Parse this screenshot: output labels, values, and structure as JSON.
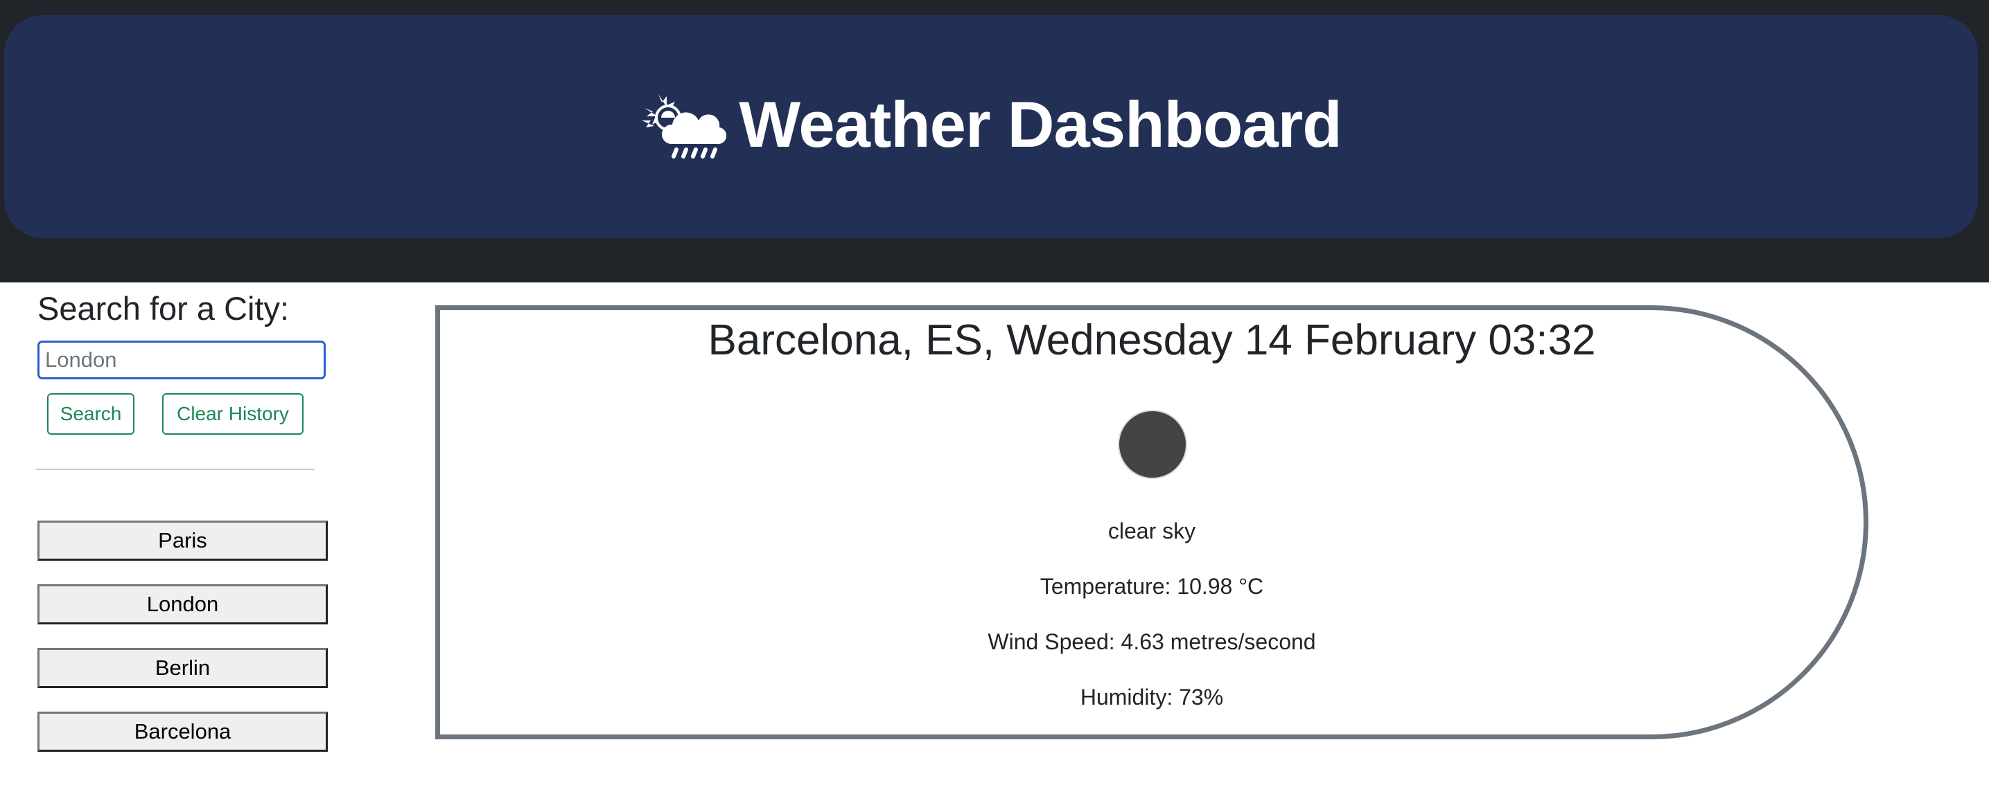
{
  "header": {
    "title": "Weather Dashboard",
    "icon": "cloud-sun-rain-icon"
  },
  "sidebar": {
    "heading": "Search for a City:",
    "search": {
      "value": "",
      "placeholder": "London"
    },
    "search_button_label": "Search",
    "clear_button_label": "Clear History",
    "history": [
      "Paris",
      "London",
      "Berlin",
      "Barcelona"
    ]
  },
  "weather": {
    "title": "Barcelona, ES, Wednesday 14 February 03:32",
    "icon": "weather-icon",
    "description": "clear sky",
    "temperature": "Temperature: 10.98 °C",
    "wind_speed": "Wind Speed: 4.63 metres/second",
    "humidity": "Humidity: 73%"
  },
  "colors": {
    "page_background": "#212529",
    "header_background": "#233055",
    "button_accent": "#198754",
    "card_border": "#6c757d",
    "input_focus_border": "#2a5fc9"
  }
}
